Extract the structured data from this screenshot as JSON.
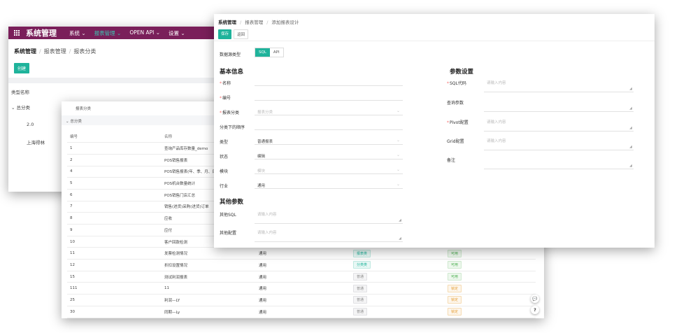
{
  "win1": {
    "app_title": "系统管理",
    "nav": [
      {
        "label": "系统 ⌄"
      },
      {
        "label": "报表管理 ⌄"
      },
      {
        "label": "OPEN API ⌄"
      },
      {
        "label": "设置 ⌄"
      }
    ],
    "breadcrumb": [
      "系统管理",
      "报表管理",
      "报表分类"
    ],
    "new_button": "创建",
    "column_header": "类型名称",
    "tree": [
      {
        "label": "⌄ 总分类"
      },
      {
        "label": "2.0"
      },
      {
        "label": "上海得林"
      }
    ]
  },
  "win2": {
    "header_1": "报表分类",
    "header_2": "⌄     总分类",
    "columns": [
      "编号",
      "名称",
      "",
      "",
      ""
    ],
    "rows": [
      {
        "id": "1",
        "name": "查询产品库存数量_demo",
        "c3": "",
        "c4": "",
        "c4t": "",
        "c5": "",
        "c5t": ""
      },
      {
        "id": "2",
        "name": "POS销售报表",
        "c3": "",
        "c4": "",
        "c4t": "",
        "c5": "",
        "c5t": ""
      },
      {
        "id": "4",
        "name": "POS销售报表(年、季、月、日)",
        "c3": "",
        "c4": "",
        "c4t": "",
        "c5": "",
        "c5t": ""
      },
      {
        "id": "5",
        "name": "POS机台数量统计",
        "c3": "",
        "c4": "",
        "c4t": "",
        "c5": "",
        "c5t": ""
      },
      {
        "id": "6",
        "name": "POS销售门店汇总",
        "c3": "",
        "c4": "",
        "c4t": "",
        "c5": "",
        "c5t": ""
      },
      {
        "id": "7",
        "name": "销售(进货)采购(进货)订单",
        "c3": "",
        "c4": "",
        "c4t": "",
        "c5": "",
        "c5t": ""
      },
      {
        "id": "8",
        "name": "应收",
        "c3": "",
        "c4": "",
        "c4t": "",
        "c5": "",
        "c5t": ""
      },
      {
        "id": "9",
        "name": "应付",
        "c3": "",
        "c4": "",
        "c4t": "",
        "c5": "",
        "c5t": ""
      },
      {
        "id": "10",
        "name": "客户回款检测",
        "c3": "",
        "c4": "",
        "c4t": "",
        "c5": "",
        "c5t": ""
      },
      {
        "id": "11",
        "name": "发票检测情况",
        "c3": "通用",
        "c4": "报表类",
        "c4t": "cyan",
        "c5": "可用",
        "c5t": "green"
      },
      {
        "id": "12",
        "name": "折扣设置情况",
        "c3": "通用",
        "c4": "分类类",
        "c4t": "cyan",
        "c5": "可用",
        "c5t": "green"
      },
      {
        "id": "15",
        "name": "测试利润报表",
        "c3": "通用",
        "c4": "普通",
        "c4t": "gray",
        "c5": "可用",
        "c5t": "green"
      },
      {
        "id": "111",
        "name": "11",
        "c3": "通用",
        "c4": "普通",
        "c4t": "gray",
        "c5": "锁定",
        "c5t": "orange"
      },
      {
        "id": "25",
        "name": "利润—LY",
        "c3": "通用",
        "c4": "普通",
        "c4t": "gray",
        "c5": "锁定",
        "c5t": "orange"
      },
      {
        "id": "30",
        "name": "同期—Ly",
        "c3": "通用",
        "c4": "普通",
        "c4t": "gray",
        "c5": "锁定",
        "c5t": "orange"
      }
    ],
    "fab_chat": "💬",
    "fab_help": "?"
  },
  "win3": {
    "breadcrumb": [
      "系统管理",
      "报表管理",
      "添加报表设计"
    ],
    "save_button": "保存",
    "back_button": "返回",
    "datasource_label": "数据源类型",
    "datasource_options": [
      "SQL",
      "API"
    ],
    "basic_section": "基本信息",
    "basic_fields": [
      {
        "label": "名称",
        "required": true,
        "value": "",
        "placeholder": "",
        "select": false
      },
      {
        "label": "编号",
        "required": true,
        "value": "",
        "placeholder": "",
        "select": false
      },
      {
        "label": "报表分类",
        "required": true,
        "value": "",
        "placeholder": "报表分类",
        "select": true
      },
      {
        "label": "分类下的顺序",
        "required": false,
        "value": "",
        "placeholder": "",
        "select": false
      },
      {
        "label": "类型",
        "required": false,
        "value": "普通报表",
        "placeholder": "",
        "select": true
      },
      {
        "label": "状态",
        "required": false,
        "value": "编辑",
        "placeholder": "",
        "select": true
      },
      {
        "label": "模块",
        "required": false,
        "value": "",
        "placeholder": "模块",
        "select": true
      },
      {
        "label": "行业",
        "required": false,
        "value": "通用",
        "placeholder": "",
        "select": true
      }
    ],
    "other_section": "其他参数",
    "other_fields": [
      {
        "label": "其他SQL",
        "placeholder": "请输入内容"
      },
      {
        "label": "其他配置",
        "placeholder": "请输入内容"
      }
    ],
    "param_section": "参数设置",
    "param_fields": [
      {
        "label": "SQL代码",
        "required": true,
        "placeholder": "请输入内容"
      },
      {
        "label": "查询参数",
        "required": false,
        "placeholder": ""
      },
      {
        "label": "Pivot配置",
        "required": true,
        "placeholder": "请输入内容"
      },
      {
        "label": "Grid配置",
        "required": false,
        "placeholder": "请输入内容"
      },
      {
        "label": "备注",
        "required": false,
        "placeholder": ""
      }
    ]
  },
  "colors": {
    "brand_nav": "#7a1f5a",
    "accent": "#1fb39b",
    "required": "#f56c6c"
  }
}
